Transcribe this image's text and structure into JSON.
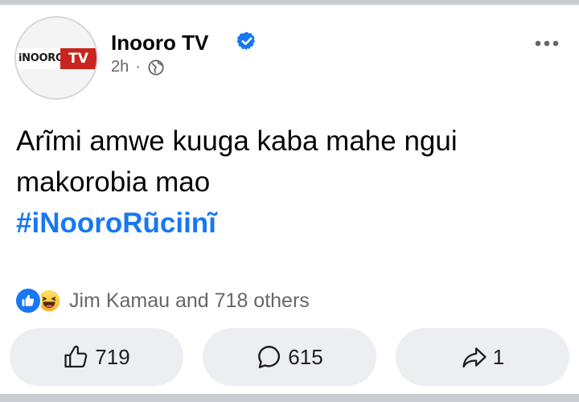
{
  "post": {
    "page_name": "Inooro TV",
    "time": "2h",
    "separator": "·",
    "verified_icon": "verified-badge-icon",
    "audience_icon": "globe-icon",
    "logo": {
      "left_text": "iNOORO",
      "right_text": "TV"
    },
    "text_line1": "Arĩmi amwe kuuga kaba mahe ngui",
    "text_line2": "makorobia mao",
    "hashtag": "#iNooroRũciinĩ"
  },
  "reactions": {
    "summary": "Jim Kamau and 718 others",
    "types": [
      "like",
      "haha"
    ]
  },
  "actions": {
    "like_count": "719",
    "comment_count": "615",
    "share_count": "1"
  },
  "colors": {
    "brand_blue": "#1877f2",
    "secondary_text": "#65676b",
    "button_bg": "#eceef1",
    "logo_red": "#c8251e"
  }
}
